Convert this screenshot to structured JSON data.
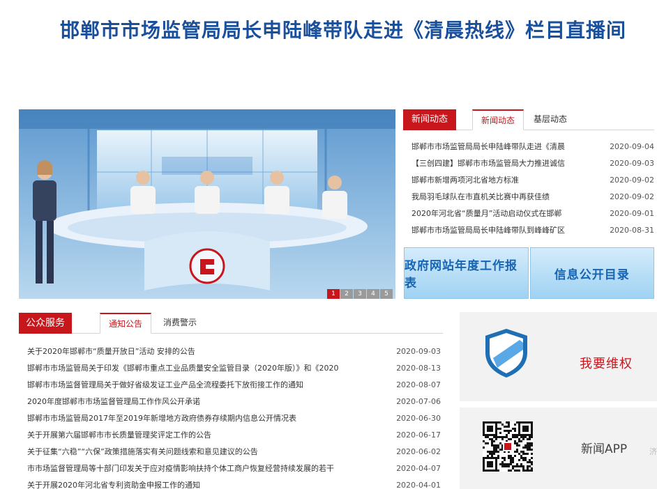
{
  "headline": "邯郸市市场监管局局长申陆峰带队走进《清晨热线》栏目直播间",
  "carousel": {
    "dots": [
      "1",
      "2",
      "3",
      "4",
      "5"
    ],
    "active_index": 0
  },
  "news": {
    "category": "新闻动态",
    "tabs": [
      "新闻动态",
      "基层动态"
    ],
    "items": [
      {
        "title": "邯郸市市场监管局局长申陆峰带队走进《清晨",
        "date": "2020-09-04"
      },
      {
        "title": "【三创四建】邯郸市市场监管局大力推进诚信",
        "date": "2020-09-03"
      },
      {
        "title": "邯郸市新增两项河北省地方标准",
        "date": "2020-09-02"
      },
      {
        "title": "我局羽毛球队在市直机关比赛中再获佳绩",
        "date": "2020-09-02"
      },
      {
        "title": "2020年河北省“质量月”活动启动仪式在邯郸",
        "date": "2020-09-01"
      },
      {
        "title": "邯郸市市场监管局局长申陆峰带队到峰峰矿区",
        "date": "2020-08-31"
      }
    ]
  },
  "banners": {
    "work_report": "政府网站年度工作报表",
    "info_catalog": "信息公开目录"
  },
  "service": {
    "category": "公众服务",
    "tabs": [
      "通知公告",
      "消费警示"
    ],
    "items": [
      {
        "title": "关于2020年邯郸市“质量开放日”活动 安排的公告",
        "date": "2020-09-03"
      },
      {
        "title": "邯郸市市场监管局关于印发《邯郸市重点工业品质量安全监管目录（2020年版）》和《2020",
        "date": "2020-08-13"
      },
      {
        "title": "邯郸市市场监督管理局关于做好省级发证工业产品全流程委托下放衔接工作的通知",
        "date": "2020-08-07"
      },
      {
        "title": "2020年度邯郸市市场监督管理局工作作风公开承诺",
        "date": "2020-07-06"
      },
      {
        "title": "邯郸市市场监管局2017年至2019年新增地方政府债券存续期内信息公开情况表",
        "date": "2020-06-30"
      },
      {
        "title": "关于开展第六届邯郸市市长质量管理奖评定工作的公告",
        "date": "2020-06-17"
      },
      {
        "title": "关于征集“六稳”“六保”政策措施落实有关问题线索和意见建议的公告",
        "date": "2020-06-02"
      },
      {
        "title": "市市场监督管理局等十部门印发关于应对疫情影响扶持个体工商户恢复经营持续发展的若干",
        "date": "2020-04-07"
      },
      {
        "title": "关于开展2020年河北省专利资助金申报工作的通知",
        "date": "2020-04-01"
      }
    ]
  },
  "rights": {
    "label": "我要维权",
    "icon": "shield-icon"
  },
  "app": {
    "label": "新闻APP",
    "icon": "qr-code-icon",
    "edge_text": "济"
  },
  "colors": {
    "brand_red": "#c8161d",
    "headline_blue": "#1a4f9c",
    "banner_text": "#1664b3"
  }
}
